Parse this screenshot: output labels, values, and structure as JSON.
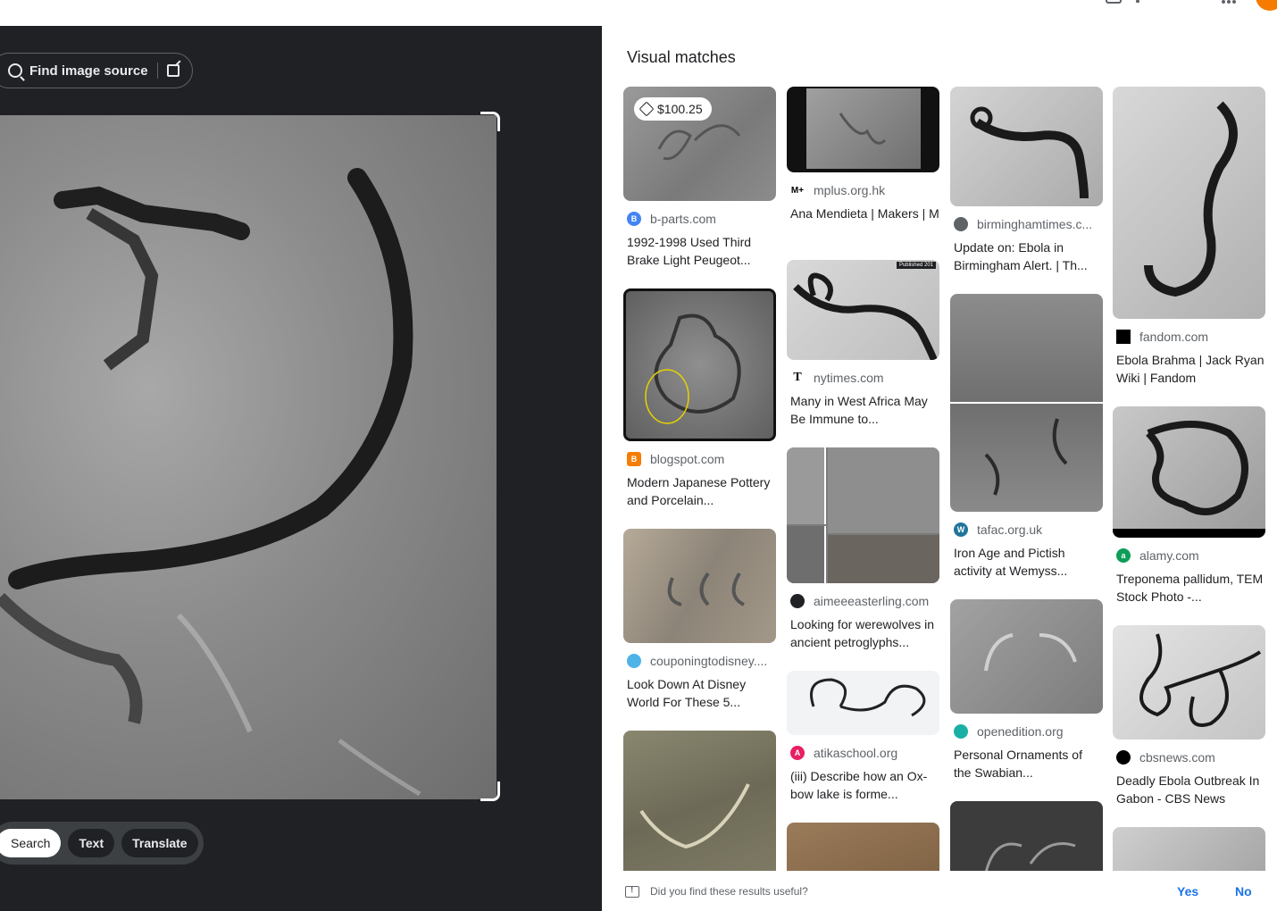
{
  "lens": {
    "find_source_label": "Find image source",
    "modes": [
      "Search",
      "Text",
      "Translate"
    ]
  },
  "results": {
    "title": "Visual matches",
    "columns": [
      [
        {
          "source": "b-parts.com",
          "caption": "1992-1998 Used Third Brake Light Peugeot...",
          "price": "$100.25"
        },
        {
          "source": "blogspot.com",
          "caption": "Modern Japanese Pottery and Porcelain..."
        },
        {
          "source": "couponingtodisney....",
          "caption": "Look Down At Disney World For These 5..."
        },
        {
          "source": "",
          "caption": ""
        }
      ],
      [
        {
          "source": "mplus.org.hk",
          "caption": "Ana Mendieta | Makers | M"
        },
        {
          "source": "nytimes.com",
          "caption": "Many in West Africa May Be Immune to..."
        },
        {
          "source": "aimeeeasterling.com",
          "caption": "Looking for werewolves in ancient petroglyphs..."
        },
        {
          "source": "atikaschool.org",
          "caption": "(iii) Describe how an Ox- bow lake is forme..."
        },
        {
          "source": "",
          "caption": ""
        }
      ],
      [
        {
          "source": "birminghamtimes.c...",
          "caption": "Update on: Ebola in Birmingham Alert. | Th..."
        },
        {
          "source": "tafac.org.uk",
          "caption": "Iron Age and Pictish activity at Wemyss..."
        },
        {
          "source": "openedition.org",
          "caption": "Personal Ornaments of the Swabian..."
        },
        {
          "source": "",
          "caption": ""
        }
      ],
      [
        {
          "source": "fandom.com",
          "caption": "Ebola Brahma | Jack Ryan Wiki | Fandom"
        },
        {
          "source": "alamy.com",
          "caption": "Treponema pallidum, TEM Stock Photo -..."
        },
        {
          "source": "cbsnews.com",
          "caption": "Deadly Ebola Outbreak In Gabon - CBS News"
        },
        {
          "source": "",
          "caption": ""
        }
      ]
    ],
    "thumb_badges": {
      "nyt_published": "Published 201"
    }
  },
  "feedback": {
    "question": "Did you find these results useful?",
    "yes": "Yes",
    "no": "No"
  },
  "colors": {
    "accent": "#1a73e8",
    "left_panel_bg": "#202124"
  }
}
